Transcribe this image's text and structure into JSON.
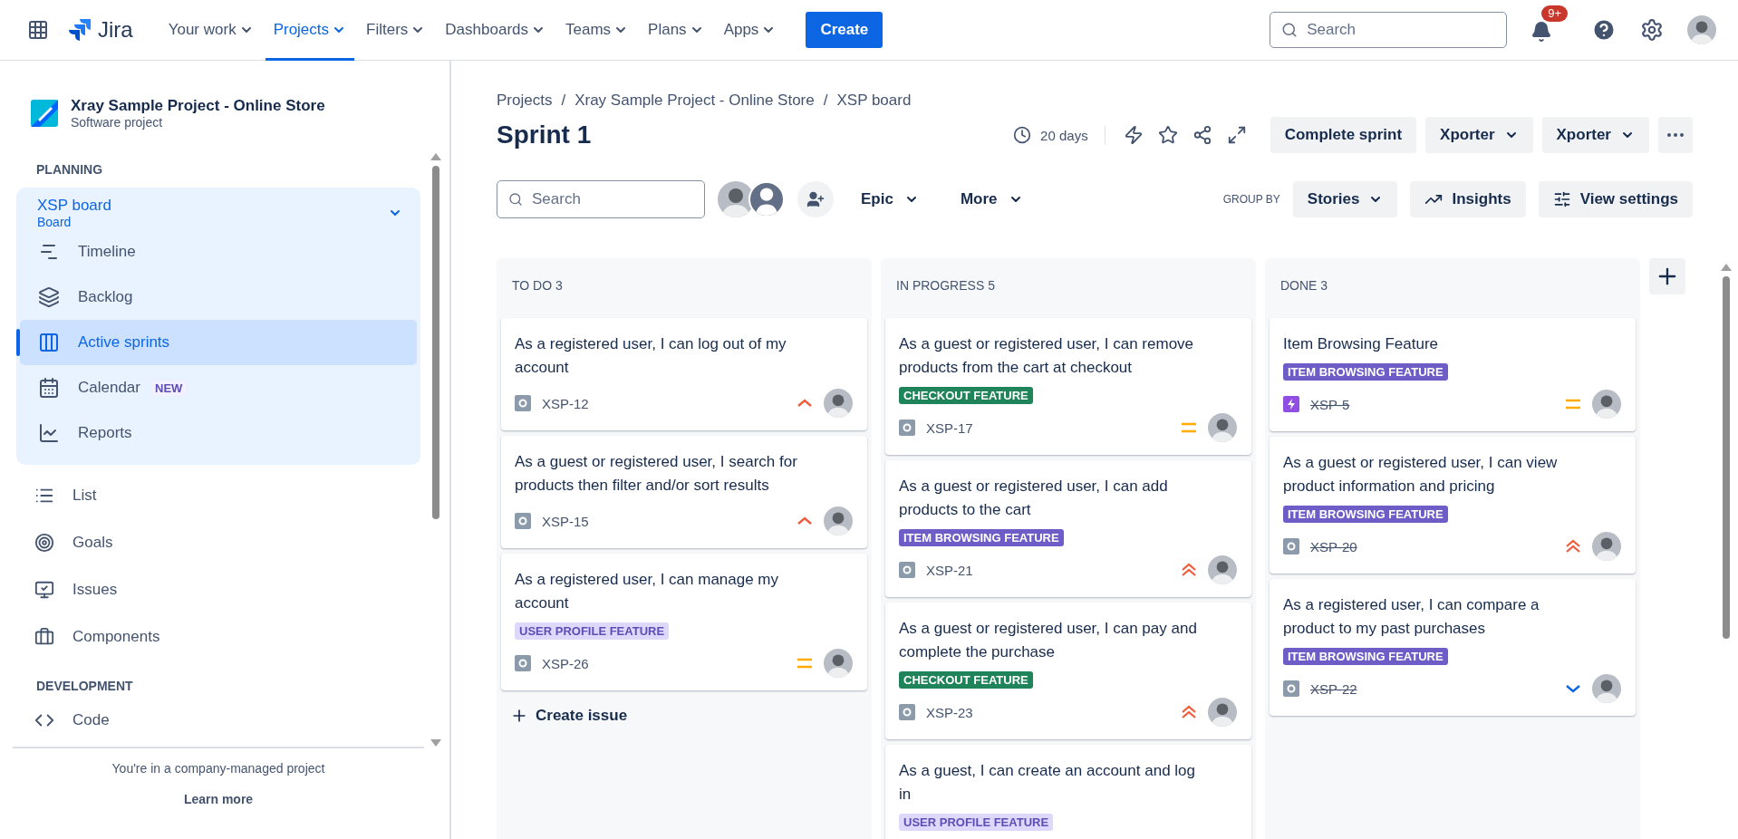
{
  "topnav": {
    "product": "Jira",
    "menus": [
      {
        "label": "Your work",
        "selected": false
      },
      {
        "label": "Projects",
        "selected": true
      },
      {
        "label": "Filters",
        "selected": false
      },
      {
        "label": "Dashboards",
        "selected": false
      },
      {
        "label": "Teams",
        "selected": false
      },
      {
        "label": "Plans",
        "selected": false
      },
      {
        "label": "Apps",
        "selected": false
      }
    ],
    "create": "Create",
    "search": {
      "placeholder": "Search"
    },
    "notifications_badge": "9+"
  },
  "sidebar": {
    "project": {
      "name": "Xray Sample Project - Online Store",
      "type": "Software project"
    },
    "planning_heading": "PLANNING",
    "board": {
      "name": "XSP board",
      "type": "Board",
      "expanded": true,
      "items": [
        {
          "label": "Timeline",
          "selected": false
        },
        {
          "label": "Backlog",
          "selected": false
        },
        {
          "label": "Active sprints",
          "selected": true
        },
        {
          "label": "Calendar",
          "selected": false,
          "badge": "NEW"
        },
        {
          "label": "Reports",
          "selected": false
        }
      ]
    },
    "items": [
      {
        "label": "List"
      },
      {
        "label": "Goals"
      },
      {
        "label": "Issues"
      },
      {
        "label": "Components"
      }
    ],
    "development_heading": "DEVELOPMENT",
    "dev_items": [
      {
        "label": "Code"
      }
    ],
    "footer": {
      "text": "You're in a company-managed project",
      "link": "Learn more"
    }
  },
  "breadcrumbs": {
    "separator": "/",
    "items": [
      "Projects",
      "Xray Sample Project - Online Store",
      "XSP board"
    ]
  },
  "title": "Sprint 1",
  "days_left": "20 days",
  "actions": [
    {
      "label": "Complete sprint",
      "kind": "plain"
    },
    {
      "label": "Xporter",
      "kind": "dropdown"
    },
    {
      "label": "Xporter",
      "kind": "dropdown"
    }
  ],
  "filters": {
    "search": {
      "placeholder": "Search"
    },
    "dropdowns": [
      "Epic",
      "More"
    ],
    "group_by_label": "GROUP BY",
    "group_by": "Stories",
    "insights": "Insights",
    "view_settings": "View settings"
  },
  "columns": [
    {
      "title": "TO DO 3",
      "resolved": false,
      "create": "Create issue",
      "cards": [
        {
          "summary": "As a registered user, I can log out of my account",
          "key": "XSP-12",
          "kind": "story",
          "priority": {
            "kind": "high"
          }
        },
        {
          "summary": "As a guest or registered user, I search for products then filter and/or sort results",
          "key": "XSP-15",
          "kind": "story",
          "priority": {
            "kind": "high"
          }
        },
        {
          "summary": "As a registered user, I can manage my account",
          "label": {
            "text": "USER PROFILE FEATURE",
            "color": "#dfd8fd"
          },
          "key": "XSP-26",
          "kind": "story",
          "priority": {
            "kind": "medium"
          }
        }
      ]
    },
    {
      "title": "IN PROGRESS 5",
      "resolved": false,
      "cards": [
        {
          "summary": "As a guest or registered user, I can remove products from the cart at checkout",
          "label": {
            "text": "CHECKOUT FEATURE",
            "color": "#1f845a"
          },
          "key": "XSP-17",
          "kind": "story",
          "priority": {
            "kind": "medium"
          }
        },
        {
          "summary": "As a guest or registered user, I can add products to the cart",
          "label": {
            "text": "ITEM BROWSING FEATURE",
            "color": "#6e5dc6"
          },
          "key": "XSP-21",
          "kind": "story",
          "priority": {
            "kind": "highest"
          }
        },
        {
          "summary": "As a guest or registered user, I can pay and complete the purchase",
          "label": {
            "text": "CHECKOUT FEATURE",
            "color": "#1f845a"
          },
          "key": "XSP-23",
          "kind": "story",
          "priority": {
            "kind": "highest"
          }
        },
        {
          "summary": "As a guest, I can create an account and log in",
          "label": {
            "text": "USER PROFILE FEATURE",
            "color": "#dfd8fd"
          }
        }
      ]
    },
    {
      "title": "DONE 3",
      "resolved": true,
      "cards": [
        {
          "summary": "Item Browsing Feature",
          "label": {
            "text": "ITEM BROWSING FEATURE",
            "color": "#6e5dc6"
          },
          "key": "XSP-5",
          "kind": "epic",
          "priority": {
            "kind": "medium"
          }
        },
        {
          "summary": "As a guest or registered user, I can view product information and pricing",
          "label": {
            "text": "ITEM BROWSING FEATURE",
            "color": "#6e5dc6"
          },
          "key": "XSP-20",
          "kind": "story",
          "priority": {
            "kind": "highest"
          }
        },
        {
          "summary": "As a registered user, I can compare a product to my past purchases",
          "label": {
            "text": "ITEM BROWSING FEATURE",
            "color": "#6e5dc6"
          },
          "key": "XSP-22",
          "kind": "story",
          "priority": {
            "kind": "low"
          }
        }
      ]
    }
  ]
}
